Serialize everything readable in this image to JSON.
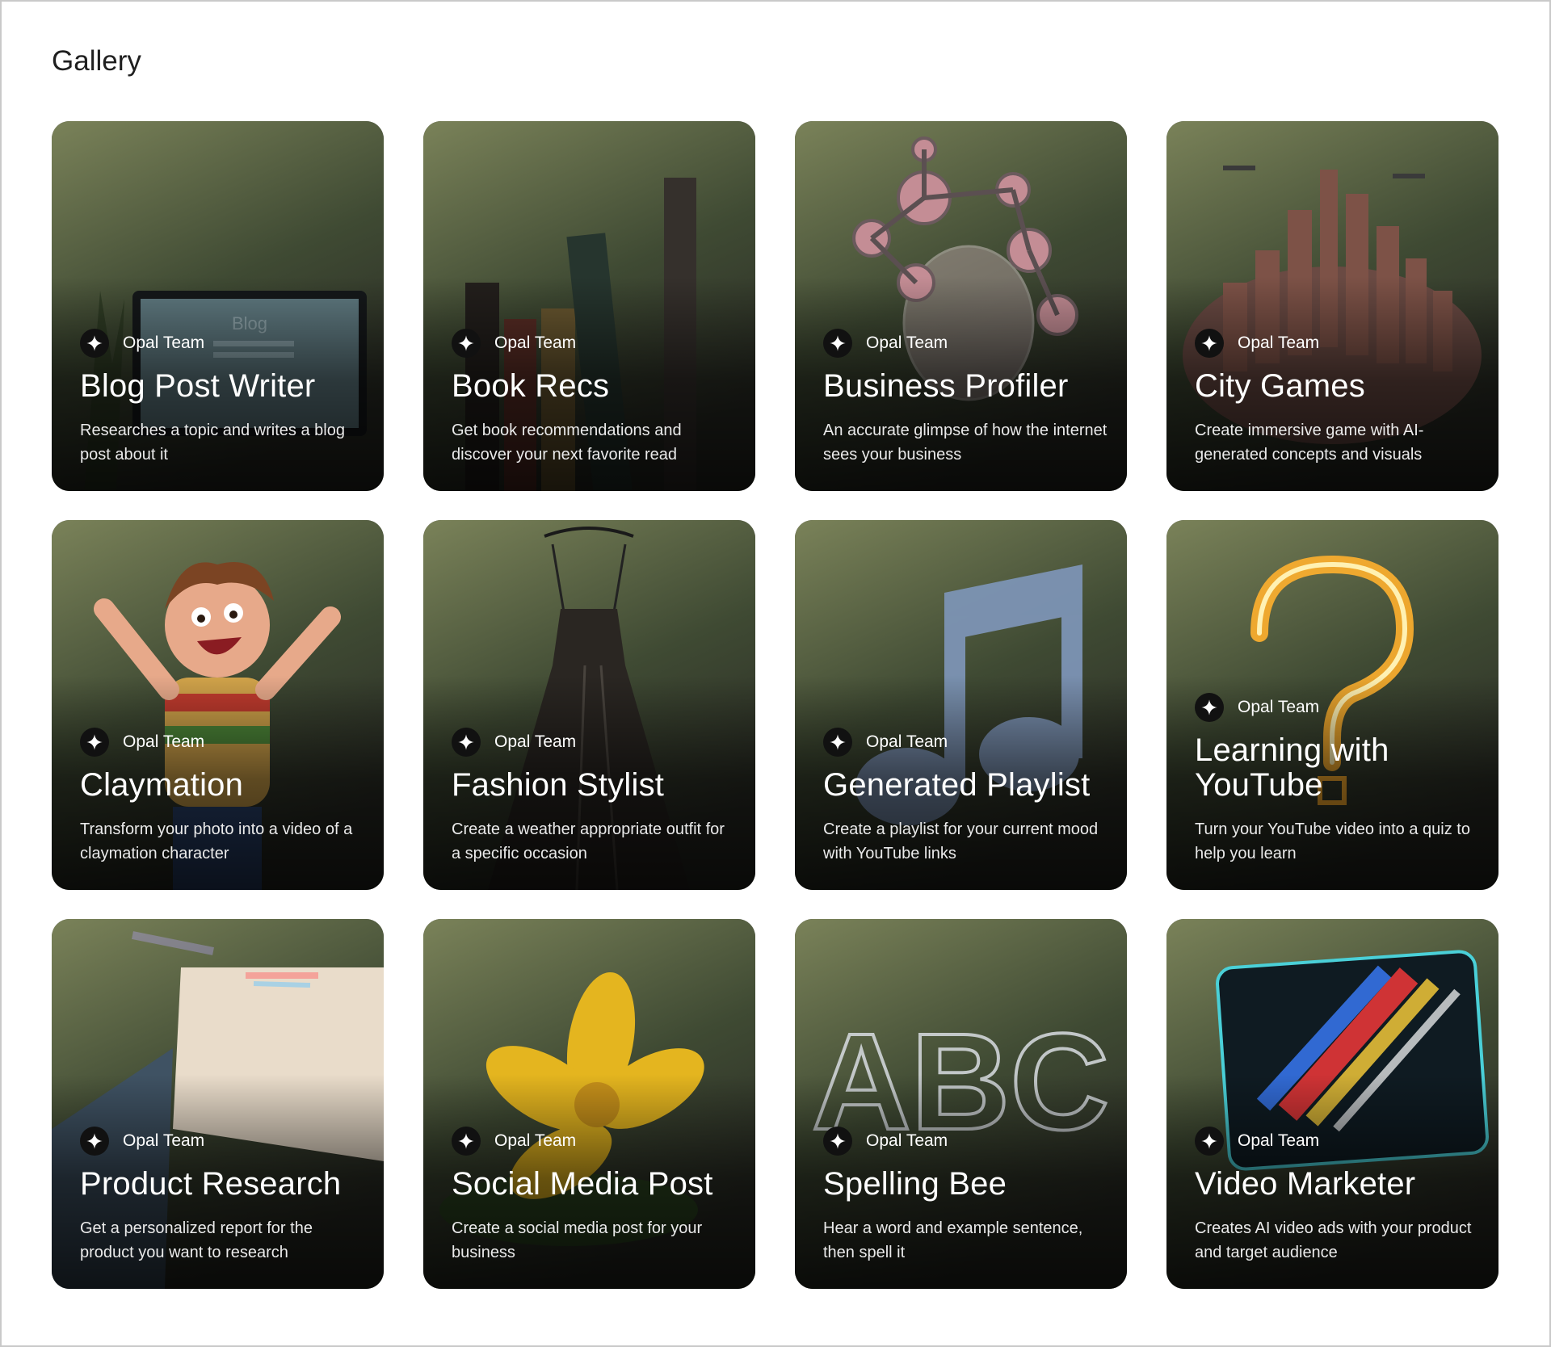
{
  "page": {
    "title": "Gallery"
  },
  "cards": [
    {
      "author": "Opal Team",
      "title": "Blog Post Writer",
      "description": "Researches a topic and writes a blog post about it",
      "art": "laptop-blog",
      "art_label": "Blog",
      "colors": [
        "#7a8259",
        "#3f4a33",
        "#2a2c25"
      ]
    },
    {
      "author": "Opal Team",
      "title": "Book Recs",
      "description": "Get book recommendations and discover your next favorite read",
      "art": "books",
      "colors": [
        "#4a4a47",
        "#2d2d2b",
        "#1b1b1a"
      ]
    },
    {
      "author": "Opal Team",
      "title": "Business Profiler",
      "description": "An accurate glimpse of how the internet sees your business",
      "art": "molecule-bulb",
      "colors": [
        "#d7a7ad",
        "#9c8486",
        "#5a5153"
      ]
    },
    {
      "author": "Opal Team",
      "title": "City Games",
      "description": "Create immersive game with AI-generated concepts and visuals",
      "art": "city",
      "colors": [
        "#d6d6d6",
        "#8e8a88",
        "#5c4b46"
      ]
    },
    {
      "author": "Opal Team",
      "title": "Claymation",
      "description": "Transform your photo into a video of a claymation character",
      "art": "clay-boy",
      "colors": [
        "#7cb6cf",
        "#3b6f86",
        "#1e3a46"
      ]
    },
    {
      "author": "Opal Team",
      "title": "Fashion Stylist",
      "description": "Create a weather appropriate outfit for a specific occasion",
      "art": "dress",
      "colors": [
        "#b8b8b8",
        "#7a7a7a",
        "#3c3c3c"
      ]
    },
    {
      "author": "Opal Team",
      "title": "Generated Playlist",
      "description": "Create a playlist for your current mood with YouTube links",
      "art": "music-note",
      "colors": [
        "#c9ab82",
        "#8a7154",
        "#4a3d30"
      ]
    },
    {
      "author": "Opal Team",
      "title": "Learning with YouTube",
      "description": "Turn your YouTube video into a quiz to help you learn",
      "art": "question-neon",
      "colors": [
        "#b51212",
        "#6b0707",
        "#2a0303"
      ]
    },
    {
      "author": "Opal Team",
      "title": "Product Research",
      "description": "Get a personalized report for the product you want to research",
      "art": "paper-prism",
      "colors": [
        "#c4a793",
        "#7e6c61",
        "#2d3440"
      ]
    },
    {
      "author": "Opal Team",
      "title": "Social Media Post",
      "description": "Create a social media post for your business",
      "art": "flower",
      "colors": [
        "#a9aca5",
        "#63665e",
        "#2e302b"
      ]
    },
    {
      "author": "Opal Team",
      "title": "Spelling Bee",
      "description": "Hear a word and example sentence, then spell it",
      "art": "glass-abc",
      "colors": [
        "#6e88a0",
        "#5a5b60",
        "#4a3b34"
      ]
    },
    {
      "author": "Opal Team",
      "title": "Video Marketer",
      "description": "Creates AI video ads with your product and target audience",
      "art": "tablet-light",
      "colors": [
        "#0b1418",
        "#091012",
        "#050808"
      ]
    }
  ]
}
